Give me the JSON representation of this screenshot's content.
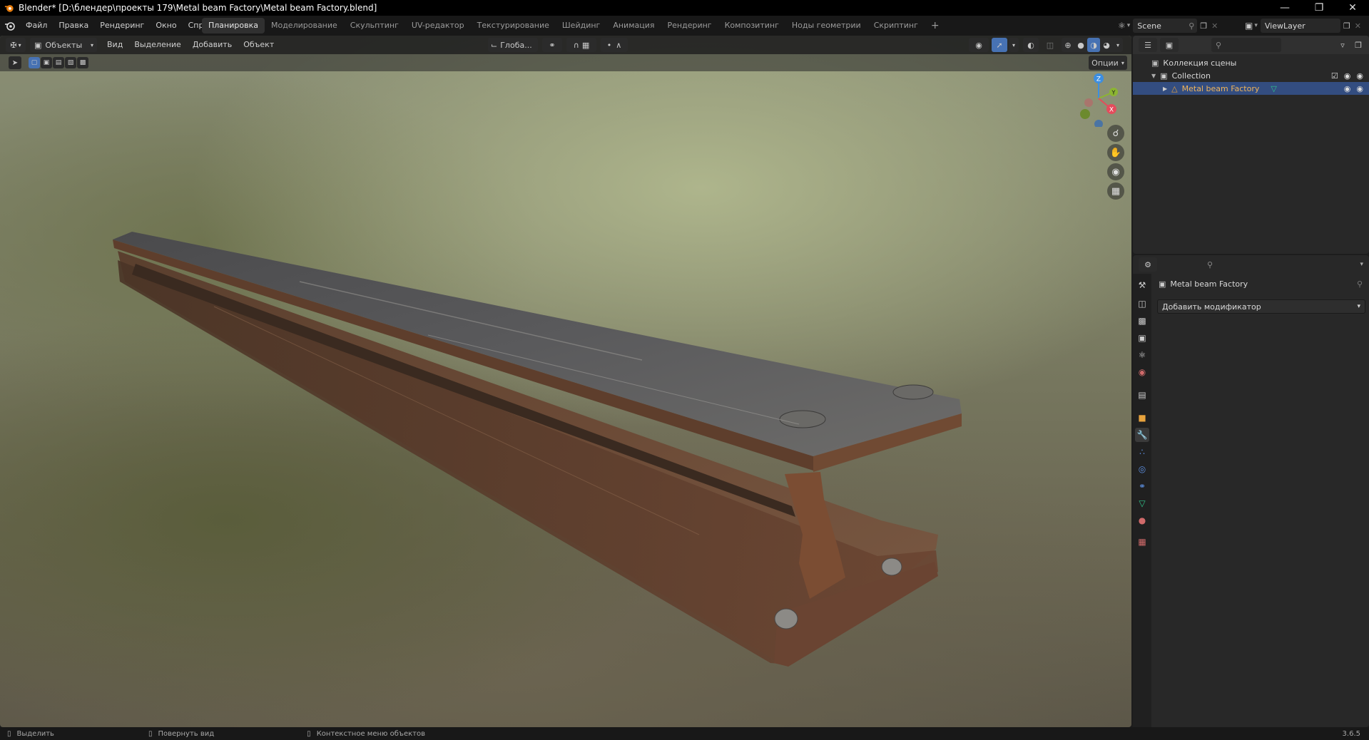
{
  "window": {
    "title": "Blender* [D:\\блендер\\проекты 179\\Metal beam Factory\\Metal beam Factory.blend]"
  },
  "menu": {
    "file": "Файл",
    "edit": "Правка",
    "render": "Рендеринг",
    "window": "Окно",
    "help": "Справка"
  },
  "workspaces": [
    "Планировка",
    "Моделирование",
    "Скульптинг",
    "UV-редактор",
    "Текстурирование",
    "Шейдинг",
    "Анимация",
    "Рендеринг",
    "Композитинг",
    "Ноды геометрии",
    "Скриптинг"
  ],
  "active_workspace": "Планировка",
  "scene": {
    "label": "Scene",
    "view_layer": "ViewLayer"
  },
  "viewport": {
    "mode": "Объекты",
    "menus": {
      "view": "Вид",
      "select": "Выделение",
      "add": "Добавить",
      "object": "Объект"
    },
    "transform_orientation": "Глоба...",
    "options": "Опции",
    "gizmo": {
      "x": "X",
      "y": "Y",
      "z": "Z"
    }
  },
  "outliner": {
    "scene_collection": "Коллекция сцены",
    "collection": "Collection",
    "object": "Metal beam Factory"
  },
  "properties": {
    "object_name": "Metal beam Factory",
    "add_modifier": "Добавить модификатор"
  },
  "status": {
    "select": "Выделить",
    "rotate": "Повернуть вид",
    "context_menu": "Контекстное меню объектов",
    "version": "3.6.5"
  },
  "colors": {
    "accent_blue": "#4772b3",
    "selected_row": "#334d80",
    "object_orange": "#e8a33d",
    "modifier_blue": "#5c8fe0",
    "mesh_green": "#2fc48b",
    "gizmo_x": "#e44c5c",
    "gizmo_y": "#8cb532",
    "gizmo_z": "#3d8ee0"
  }
}
